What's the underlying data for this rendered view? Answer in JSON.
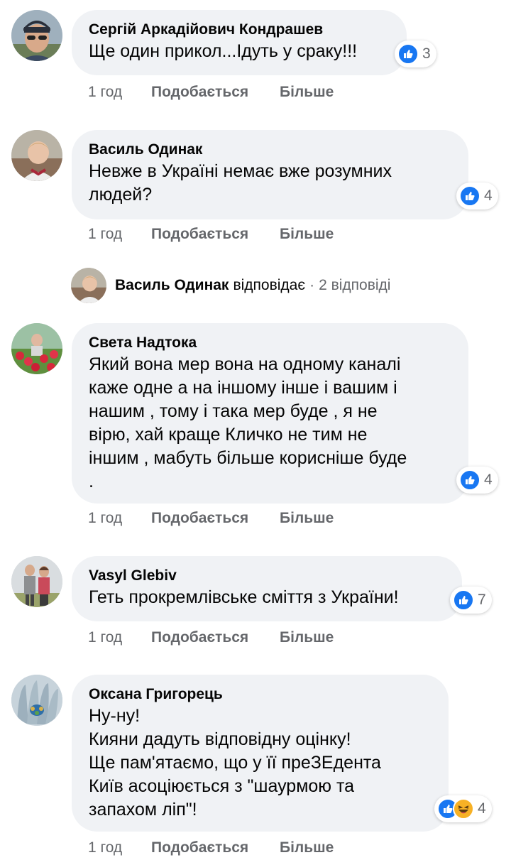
{
  "comments": [
    {
      "author": "Сергій Аркадійович Кондрашев",
      "text": "Ще один прикол...Ідуть у сраку!!!",
      "reaction_count": "3",
      "time": "1 год",
      "like_label": "Подобається",
      "more_label": "Більше"
    },
    {
      "author": "Василь Одинак",
      "text": "Невже в Україні немає вже розумних\nлюдей?",
      "reaction_count": "4",
      "time": "1 год",
      "like_label": "Подобається",
      "more_label": "Більше"
    },
    {
      "author": "Света Надтока",
      "text": "Який вона мер вона на одному каналі\nкаже одне а на іншому інше і вашим і\nнашим , тому і така мер буде , я не\nвірю, хай краще Кличко не тим не\nіншим , мабуть більше корисніше буде\n.",
      "reaction_count": "4",
      "time": "1 год",
      "like_label": "Подобається",
      "more_label": "Більше"
    },
    {
      "author": "Vasyl Glebiv",
      "text": "Геть прокремлівське сміття з України!",
      "reaction_count": "7",
      "time": "1 год",
      "like_label": "Подобається",
      "more_label": "Більше"
    },
    {
      "author": "Оксана Григорець",
      "text": "Ну-ну!\nКияни дадуть відповідну оцінку!\nЩе пам'ятаємо, що у її преЗЕдента\nКиїв асоціюється з \"шаурмою та\nзапахом ліп\"!",
      "reaction_count": "4",
      "time": "1 год",
      "like_label": "Подобається",
      "more_label": "Більше"
    }
  ],
  "reply": {
    "author": "Василь Одинак",
    "verb": "відповідає",
    "separator": "·",
    "count": "2 відповіді"
  },
  "colors": {
    "bubble": "#f0f2f5",
    "secondary_text": "#65676b",
    "like_blue": "#1877f2",
    "haha_yellow": "#f7b125"
  },
  "icons": {
    "like": "thumbs-up-icon",
    "haha": "laughing-face-icon"
  }
}
